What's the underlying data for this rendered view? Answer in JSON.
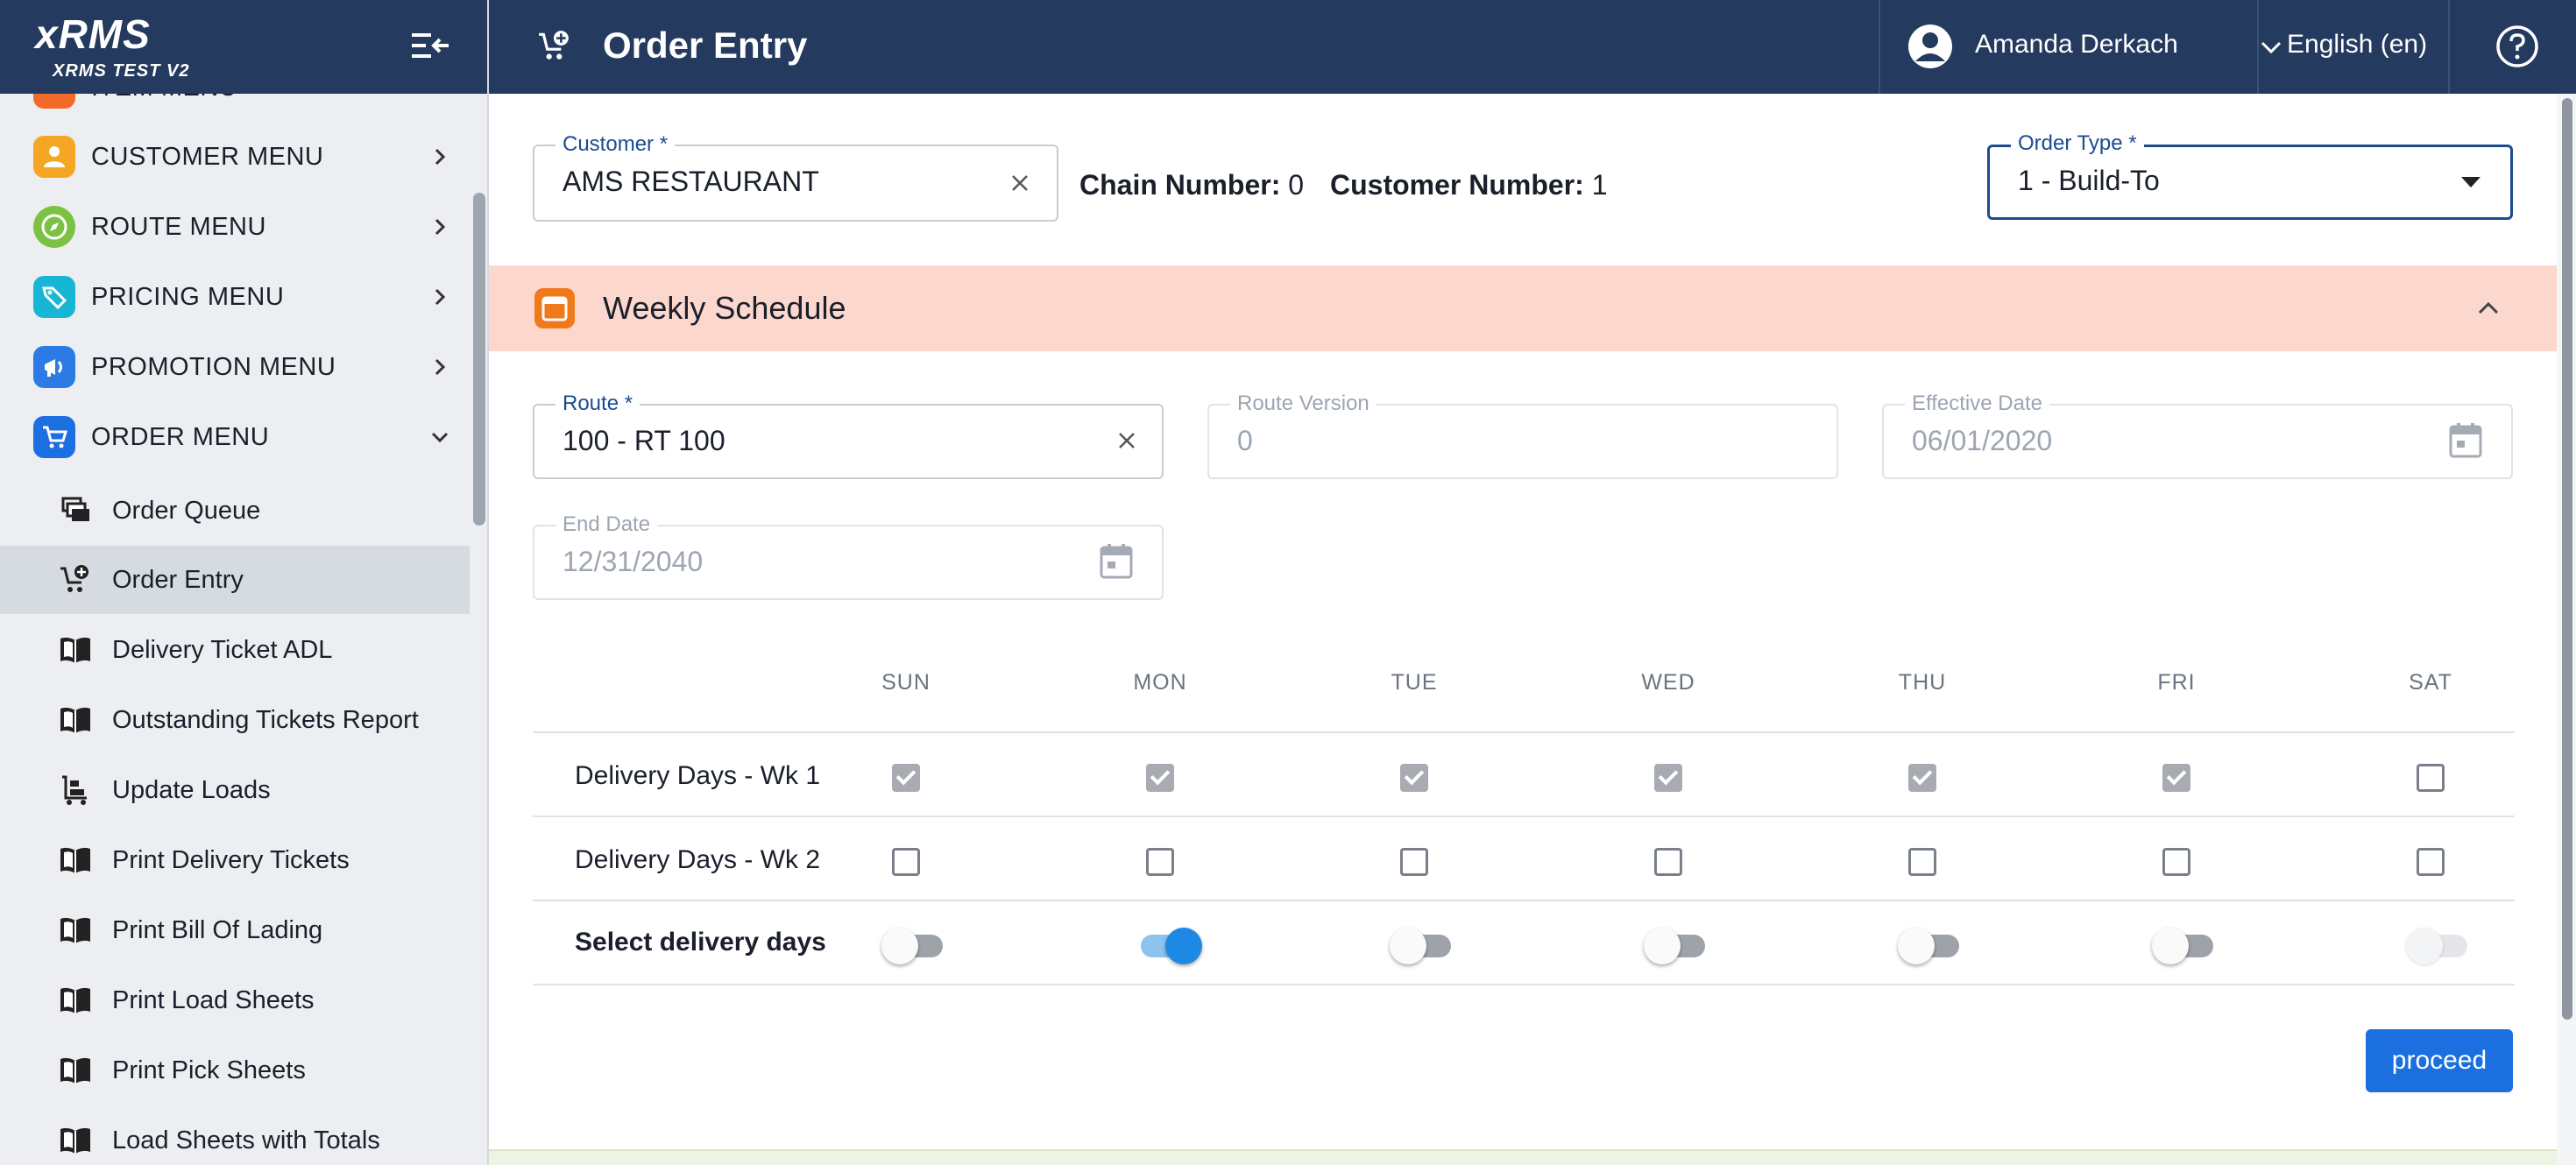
{
  "brand": {
    "logo": "xRMS",
    "subtitle": "XRMS TEST V2"
  },
  "sidebar": {
    "partial_item": {
      "label": "ITEM MENU",
      "icon": "item-menu-icon",
      "color": "#f26a2a"
    },
    "menus": [
      {
        "label": "CUSTOMER MENU",
        "icon": "customer-icon",
        "color": "#f5a623",
        "state": "collapsed"
      },
      {
        "label": "ROUTE MENU",
        "icon": "compass-icon",
        "color": "#7cc242",
        "state": "collapsed"
      },
      {
        "label": "PRICING MENU",
        "icon": "price-tag-icon",
        "color": "#17b6d4",
        "state": "collapsed"
      },
      {
        "label": "PROMOTION MENU",
        "icon": "megaphone-icon",
        "color": "#2c7be5",
        "state": "collapsed"
      },
      {
        "label": "ORDER MENU",
        "icon": "cart-icon",
        "color": "#1c6fe0",
        "state": "expanded"
      }
    ],
    "order_items": [
      {
        "label": "Order Queue",
        "icon": "queue-icon"
      },
      {
        "label": "Order Entry",
        "icon": "add-cart-icon",
        "active": true
      },
      {
        "label": "Delivery Ticket ADL",
        "icon": "book-icon"
      },
      {
        "label": "Outstanding Tickets Report",
        "icon": "book-icon"
      },
      {
        "label": "Update Loads",
        "icon": "cart-loads-icon"
      },
      {
        "label": "Print Delivery Tickets",
        "icon": "book-icon"
      },
      {
        "label": "Print Bill Of Lading",
        "icon": "book-icon"
      },
      {
        "label": "Print Load Sheets",
        "icon": "book-icon"
      },
      {
        "label": "Print Pick Sheets",
        "icon": "book-icon"
      },
      {
        "label": "Load Sheets with Totals",
        "icon": "book-icon"
      }
    ]
  },
  "header": {
    "title": "Order Entry",
    "user": "Amanda Derkach",
    "language": "English (en)"
  },
  "form": {
    "customer": {
      "label": "Customer *",
      "value": "AMS RESTAURANT"
    },
    "chain": {
      "label": "Chain Number:",
      "value": "0"
    },
    "customer_number": {
      "label": "Customer Number:",
      "value": "1"
    },
    "order_type": {
      "label": "Order Type *",
      "value": "1 - Build-To"
    }
  },
  "schedule": {
    "title": "Weekly Schedule",
    "route": {
      "label": "Route *",
      "value": "100 - RT 100"
    },
    "route_version": {
      "label": "Route Version",
      "value": "0"
    },
    "effective_date": {
      "label": "Effective Date",
      "value": "06/01/2020"
    },
    "end_date": {
      "label": "End Date",
      "value": "12/31/2040"
    },
    "days": [
      "SUN",
      "MON",
      "TUE",
      "WED",
      "THU",
      "FRI",
      "SAT"
    ],
    "rows": [
      {
        "label": "Delivery Days - Wk 1",
        "checked": [
          true,
          true,
          true,
          true,
          true,
          true,
          false
        ]
      },
      {
        "label": "Delivery Days - Wk 2",
        "checked": [
          false,
          false,
          false,
          false,
          false,
          false,
          false
        ]
      }
    ],
    "toggle_row": {
      "label": "Select delivery days",
      "on": [
        false,
        true,
        false,
        false,
        false,
        false,
        false
      ],
      "disabled": [
        false,
        false,
        false,
        false,
        false,
        false,
        true
      ]
    },
    "proceed_label": "proceed"
  },
  "colors": {
    "header": "#243a5e",
    "accent": "#1b6fde",
    "section": "#fbd7cd"
  }
}
